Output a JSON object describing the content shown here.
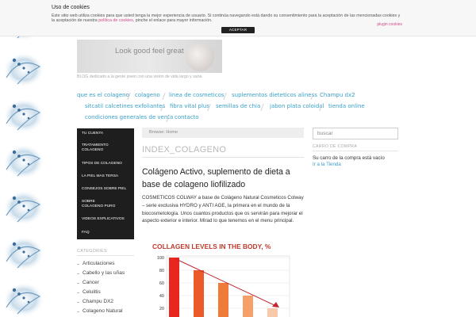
{
  "cookie": {
    "title": "Uso de cookies",
    "text_part1": "Este sitio web utiliza cookies para que usted tenga la mejor experiencia de usuario. Si continúa navegando está dando su consentimiento para la aceptación de las mencionadas cookies y la aceptación de nuestra ",
    "policy_link": "política de cookies",
    "text_part2": ", pinche el enlace para mayor información.",
    "more_link": "plugin cookies",
    "accept_label": "ACEPTAR"
  },
  "header": {
    "banner_text": "Look good feel great",
    "tagline": "BLOG dedicado a la gente joven con una visión de vida largo y sana"
  },
  "nav": {
    "items": [
      "que es el colageno",
      "colageno",
      "linea de cosmeticos",
      "suplementos dieteticos aliness",
      "Champu dx2",
      "sitcatil calcetines exfoliantes",
      "fibra vital plus",
      "semillas de chia",
      "jabon plata coloidal",
      "tienda online",
      "condiciones generales de venta",
      "contacto"
    ]
  },
  "leftmenu": {
    "items": [
      "TU CUENTA",
      "TRATAMIENTO COLAGENO",
      "TIPOS DE COLAGENO",
      "LA PIEL MAS TERSA",
      "CONSEJOS SOBRE PIEL",
      "SOBRE COLAGENO PURO",
      "VIDEOS EXPLICATIVOS",
      "FAQ"
    ]
  },
  "categories": {
    "title": "CATEGORIES",
    "items": [
      "Articulaciones",
      "Cabello y las uñas",
      "Cancer",
      "Celulitis",
      "Champu DX2",
      "Colageno Natural"
    ]
  },
  "main": {
    "breadcrumb": "Browse: Home",
    "page_title": "INDEX_COLAGENO",
    "post_title": "Colágeno Activo, suplemento de dieta a base de colageno liofilizado",
    "post_body": "COSMETICOS COLWAY a base de Colágeno Natural Cosmeticos Colway – serie exclusiva HYDRO y ANTI AGE, la primera en el mundo de la biocosmetología. Unos cuantos productos que os servirán para mejorar el aspecto exterior e interior. Mirad lo que tenemos en el menu principal."
  },
  "sidebar": {
    "search_placeholder": "buscar",
    "cart_title": "CARRO DE COMPRA",
    "cart_empty": "Su carro de la compra está vacío",
    "cart_link": "Ir a la Tienda"
  },
  "chart_data": {
    "type": "bar",
    "title": "COLLAGEN LEVELS IN THE BODY, %",
    "yticks": [
      "100",
      "80",
      "60",
      "40",
      "20"
    ],
    "ylim": [
      0,
      100
    ],
    "values": [
      100,
      80,
      60,
      40,
      20
    ],
    "colors": [
      "#e8261f",
      "#ec5a2a",
      "#f07a3a",
      "#f5a06a",
      "#f8c9a8"
    ],
    "grid": true,
    "title_color": "#c0392b"
  }
}
